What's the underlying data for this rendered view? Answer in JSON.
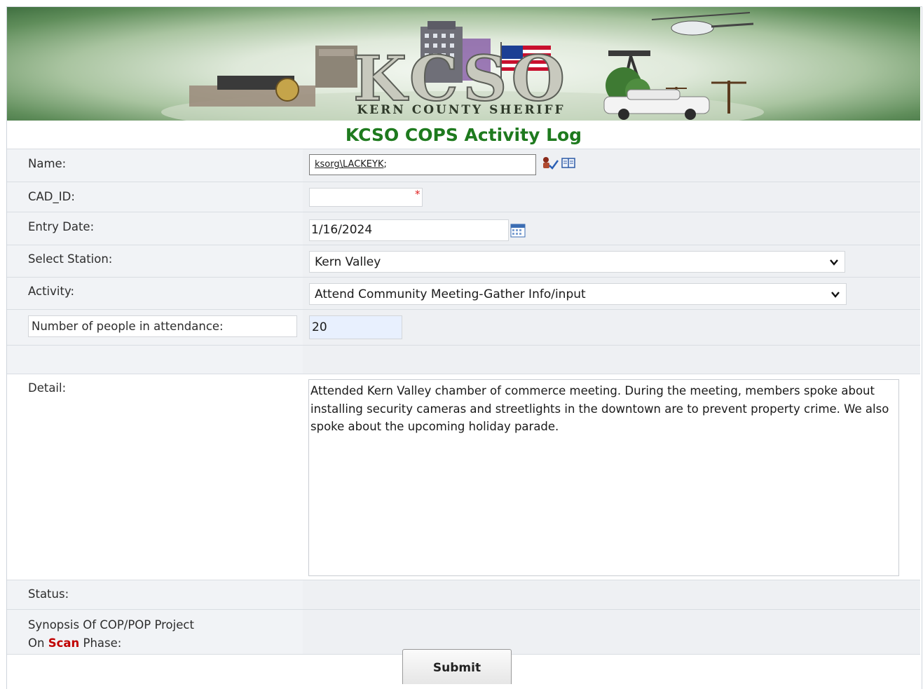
{
  "banner": {
    "logo_text": "KCSO",
    "subtitle": "KERN COUNTY SHERIFF"
  },
  "page_title": "KCSO COPS Activity Log",
  "fields": {
    "name": {
      "label": "Name:",
      "value_domain": "ksorg\\LACKEYK",
      "value_suffix": ";"
    },
    "cad_id": {
      "label": "CAD_ID:",
      "value": "",
      "required_mark": "*"
    },
    "entry_date": {
      "label": "Entry Date:",
      "value": "1/16/2024"
    },
    "station": {
      "label": "Select Station:",
      "value": "Kern Valley"
    },
    "activity": {
      "label": "Activity:",
      "value": "Attend Community Meeting-Gather Info/input"
    },
    "attendance": {
      "label": "Number of people in attendance:",
      "value": "20"
    },
    "detail": {
      "label": "Detail:",
      "value": "Attended Kern Valley chamber of commerce meeting.  During the meeting, members spoke about installing security cameras and streetlights in the downtown are to prevent property crime.   We also spoke about the upcoming holiday parade."
    },
    "status": {
      "label": "Status:"
    },
    "synopsis": {
      "label_line1": "Synopsis Of COP/POP Project",
      "label_prefix": "On ",
      "label_highlight": "Scan",
      "label_suffix": " Phase:"
    }
  },
  "submit_label": "Submit",
  "icons": [
    "check-names-icon",
    "address-book-icon",
    "calendar-icon",
    "chevron-down-icon"
  ],
  "colors": {
    "title_green": "#1e7a1e",
    "scan_red": "#c00000",
    "required_red": "#e02020"
  }
}
